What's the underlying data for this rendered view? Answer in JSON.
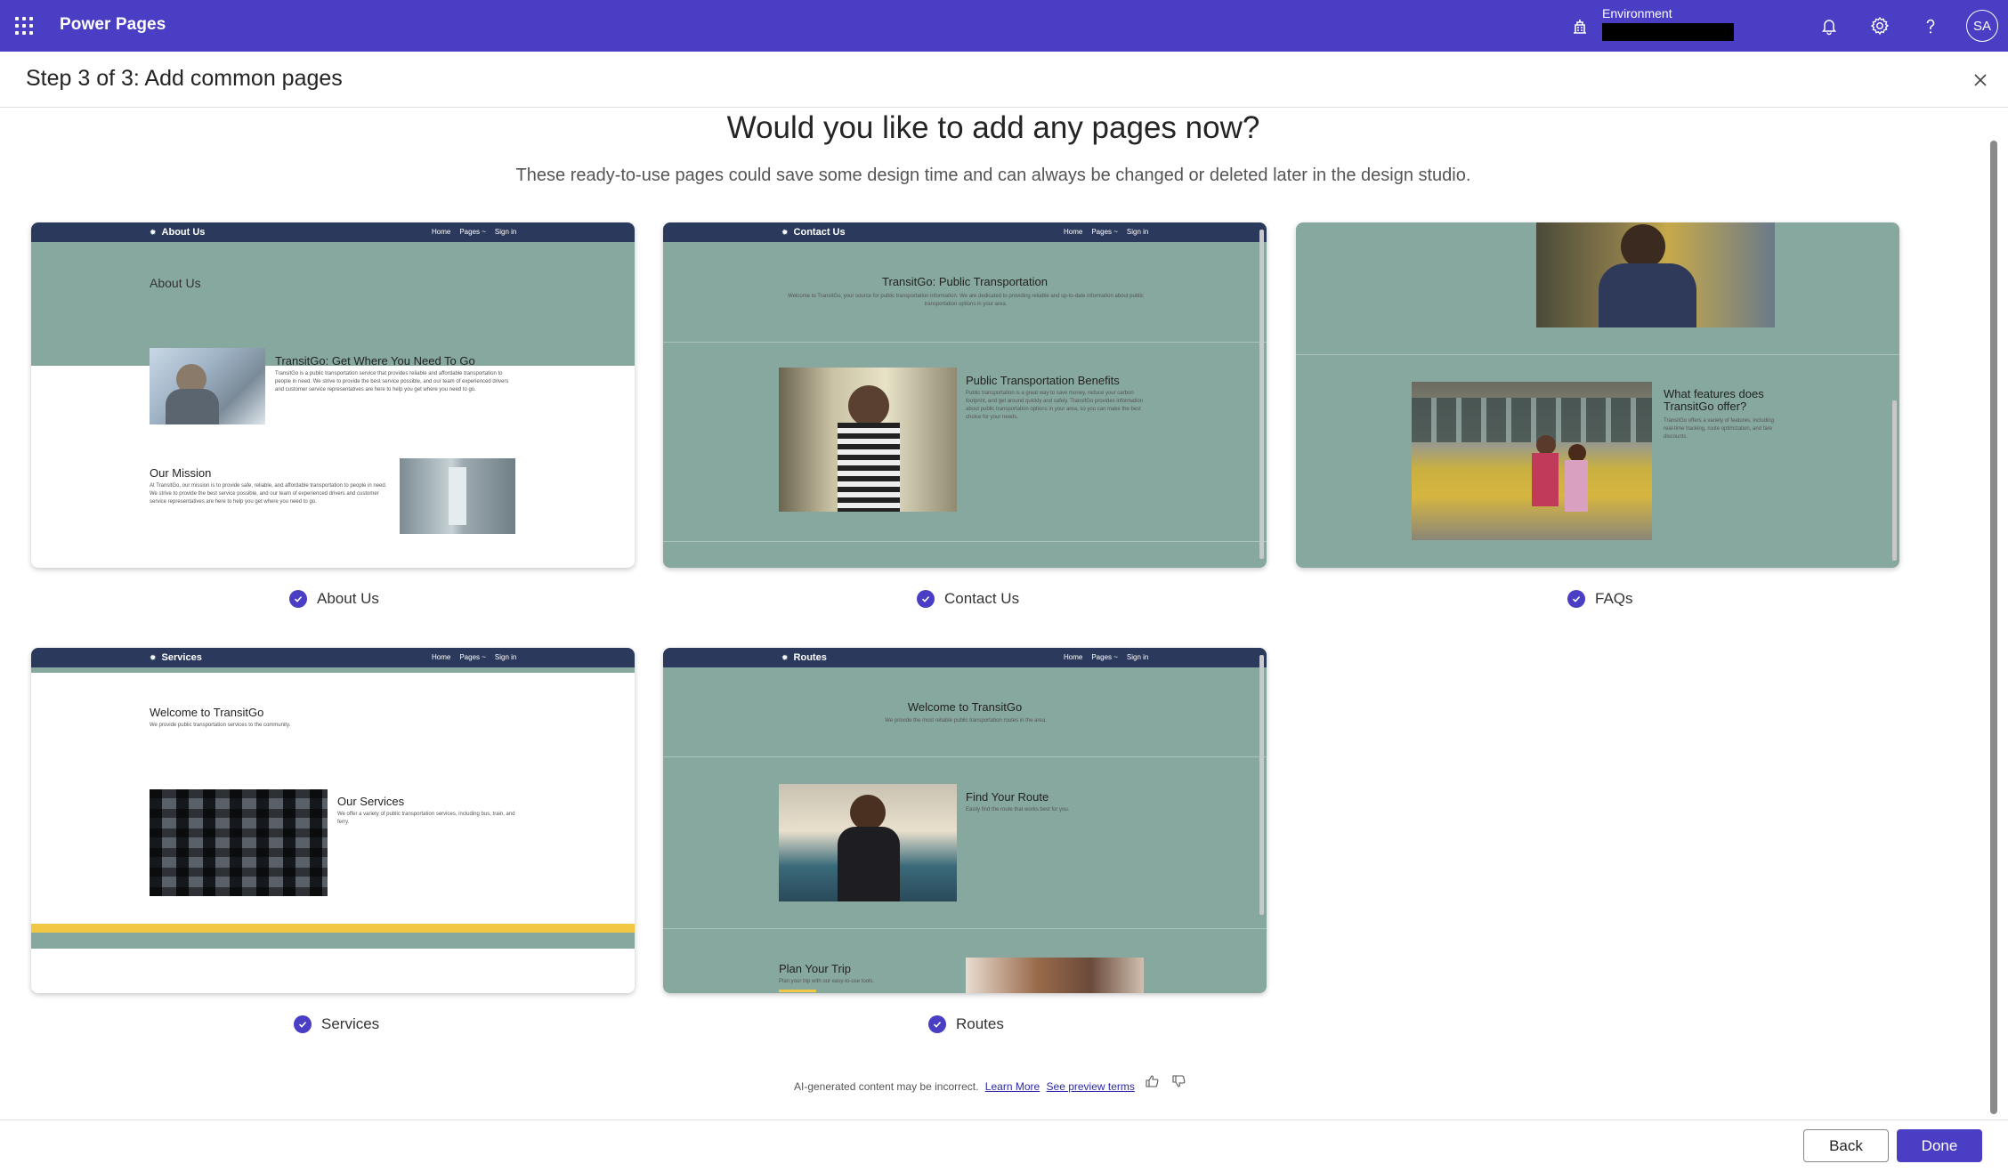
{
  "appbar": {
    "title": "Power Pages",
    "environment_label": "Environment",
    "environment_value": "",
    "avatar_initials": "SA"
  },
  "wizard": {
    "step_title": "Step 3 of 3: Add common pages",
    "heading": "Would you like to add any pages now?",
    "subheading": "These ready-to-use pages could save some design time and can always be changed or deleted later in the design studio."
  },
  "nav_links": [
    "Home",
    "Pages ~",
    "Sign in"
  ],
  "cards": [
    {
      "label": "About Us",
      "selected": true,
      "nav_brand": "About Us",
      "hero_title": "About Us",
      "section1_title": "TransitGo: Get Where You Need To Go",
      "section1_text": "TransitGo is a public transportation service that provides reliable and affordable transportation to people in need. We strive to provide the best service possible, and our team of experienced drivers and customer service representatives are here to help you get where you need to go.",
      "section2_title": "Our Mission",
      "section2_text": "At TransitGo, our mission is to provide safe, reliable, and affordable transportation to people in need. We strive to provide the best service possible, and our team of experienced drivers and customer service representatives are here to help you get where you need to go."
    },
    {
      "label": "Contact Us",
      "selected": true,
      "nav_brand": "Contact Us",
      "hero_title": "TransitGo: Public Transportation",
      "hero_text": "Welcome to TransitGo, your source for public transportation information. We are dedicated to providing reliable and up-to-date information about public transportation options in your area.",
      "section1_title": "Public Transportation Benefits",
      "section1_text": "Public transportation is a great way to save money, reduce your carbon footprint, and get around quickly and safely. TransitGo provides information about public transportation options in your area, so you can make the best choice for your needs."
    },
    {
      "label": "FAQs",
      "selected": true,
      "section1_title": "What features does TransitGo offer?",
      "section1_text": "TransitGo offers a variety of features, including real-time tracking, route optimization, and fare discounts."
    },
    {
      "label": "Services",
      "selected": true,
      "nav_brand": "Services",
      "hero_title": "Welcome to TransitGo",
      "hero_text": "We provide public transportation services to the community.",
      "section1_title": "Our Services",
      "section1_text": "We offer a variety of public transportation services, including bus, train, and ferry."
    },
    {
      "label": "Routes",
      "selected": true,
      "nav_brand": "Routes",
      "hero_title": "Welcome to TransitGo",
      "hero_text": "We provide the most reliable public transportation routes in the area.",
      "section1_title": "Find Your Route",
      "section1_text": "Easily find the route that works best for you.",
      "section2_title": "Plan Your Trip",
      "section2_text": "Plan your trip with our easy-to-use tools."
    }
  ],
  "footer_note": {
    "text": "AI-generated content may be incorrect.",
    "learn_more": "Learn More",
    "preview_terms": "See preview terms"
  },
  "buttons": {
    "back": "Back",
    "done": "Done"
  },
  "colors": {
    "brand": "#4a3ec4",
    "preview_teal": "#87a89e",
    "preview_nav": "#2b3a5c",
    "accent_yellow": "#f2c744"
  }
}
